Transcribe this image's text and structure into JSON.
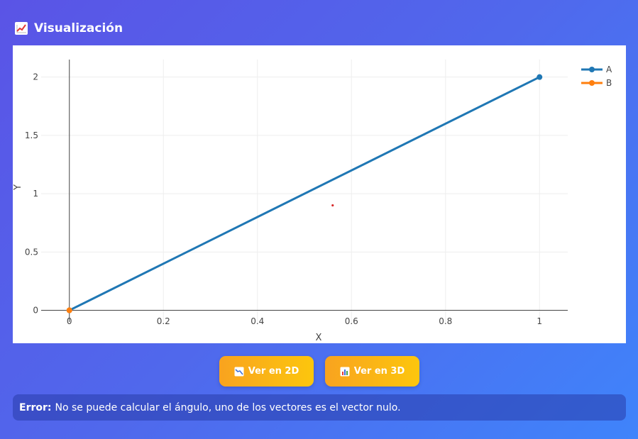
{
  "panel": {
    "title": "Visualización",
    "title_icon": "chart-increasing-icon"
  },
  "chart_data": {
    "type": "line",
    "xlabel": "X",
    "ylabel": "Y",
    "xlim": [
      -0.06,
      1.06
    ],
    "ylim": [
      -0.1,
      2.15
    ],
    "x_ticks": [
      0,
      0.2,
      0.4,
      0.6,
      0.8,
      1
    ],
    "x_tick_labels": [
      "0",
      "0.2",
      "0.4",
      "0.6",
      "0.8",
      "1"
    ],
    "y_ticks": [
      0,
      0.5,
      1,
      1.5,
      2
    ],
    "y_tick_labels": [
      "0",
      "0.5",
      "1",
      "1.5",
      "2"
    ],
    "grid": true,
    "legend_position": "top-right",
    "series": [
      {
        "name": "A",
        "color": "#1f77b4",
        "x": [
          0,
          1
        ],
        "y": [
          0,
          2
        ]
      },
      {
        "name": "B",
        "color": "#ff7f0e",
        "x": [
          0,
          0
        ],
        "y": [
          0,
          0
        ]
      }
    ],
    "annotations": [
      {
        "type": "point",
        "x": 0.56,
        "y": 0.9,
        "color": "#d62728"
      }
    ]
  },
  "buttons": {
    "view_2d_label": "Ver en 2D",
    "view_2d_icon": "chart-decreasing-icon",
    "view_3d_label": "Ver en 3D",
    "view_3d_icon": "bar-chart-icon"
  },
  "error": {
    "label": "Error:",
    "message": "No se puede calcular el ángulo, uno de los vectores es el vector nulo."
  }
}
